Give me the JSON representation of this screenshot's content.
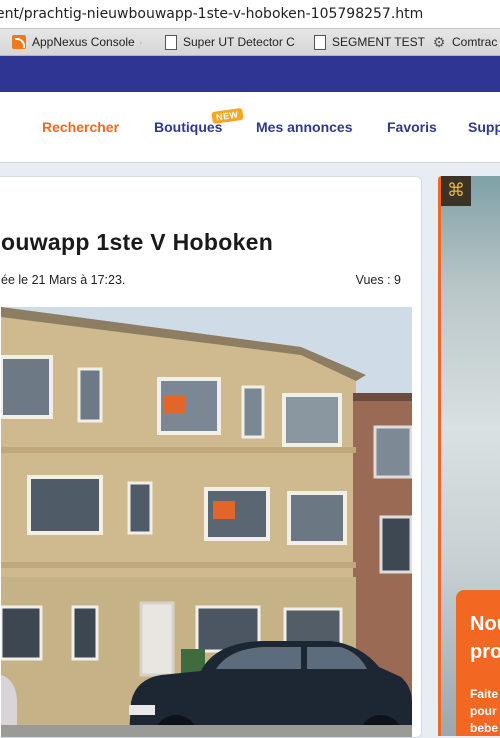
{
  "browser": {
    "url": "ent/prachtig-nieuwbouwapp-1ste-v-hoboken-105798257.htm",
    "bookmarks": [
      {
        "label": "AppNexus Console",
        "icon": "appnexus-icon"
      },
      {
        "label": "Super UT Detector C",
        "icon": "page-icon"
      },
      {
        "label": "SEGMENT TEST",
        "icon": "page-icon"
      },
      {
        "label": "Comtrac",
        "icon": "gear-icon"
      }
    ]
  },
  "nav": {
    "items": [
      "Rechercher",
      "Boutiques",
      "Mes annonces",
      "Favoris",
      "Supp"
    ],
    "active": "Rechercher",
    "badge": "NEW"
  },
  "listing": {
    "title": "ouwapp 1ste V Hoboken",
    "date": "ée le 21 Mars à 17:23.",
    "views": "Vues : 9"
  },
  "ad": {
    "heading_1": "Nou",
    "heading_2": "pro",
    "text_1": "Faite",
    "text_2": "pour",
    "text_3": "bebe"
  },
  "colors": {
    "brand_blue": "#2f3592",
    "accent_orange": "#f26722",
    "nav_text": "#2e3a8c"
  }
}
